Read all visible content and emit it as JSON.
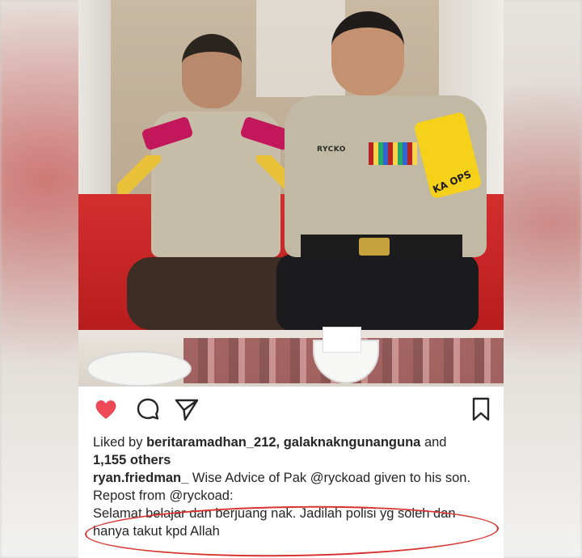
{
  "post": {
    "liked_prefix": "Liked by",
    "liked_users": "beritaramadhan_212, galaknakngunanguna",
    "liked_and": "and",
    "liked_others": "1,155 others",
    "caption_user": "ryan.friedman_",
    "caption_text": "Wise Advice of Pak @ryckoad given to his son.",
    "repost_line": "Repost from @ryckoad:",
    "quote_line1": "Selamat belajar dan berjuang nak. Jadilah polisi yg soleh dan",
    "quote_line2": "hanya takut kpd Allah"
  },
  "photo": {
    "nameplate": "RYCKO",
    "arm_patch": "KA OPS"
  },
  "icons": {
    "like": "heart-icon",
    "comment": "comment-icon",
    "share": "send-icon",
    "save": "bookmark-icon"
  },
  "colors": {
    "like_red": "#ed4956",
    "text": "#262626",
    "annotation_red": "#d8342f"
  }
}
